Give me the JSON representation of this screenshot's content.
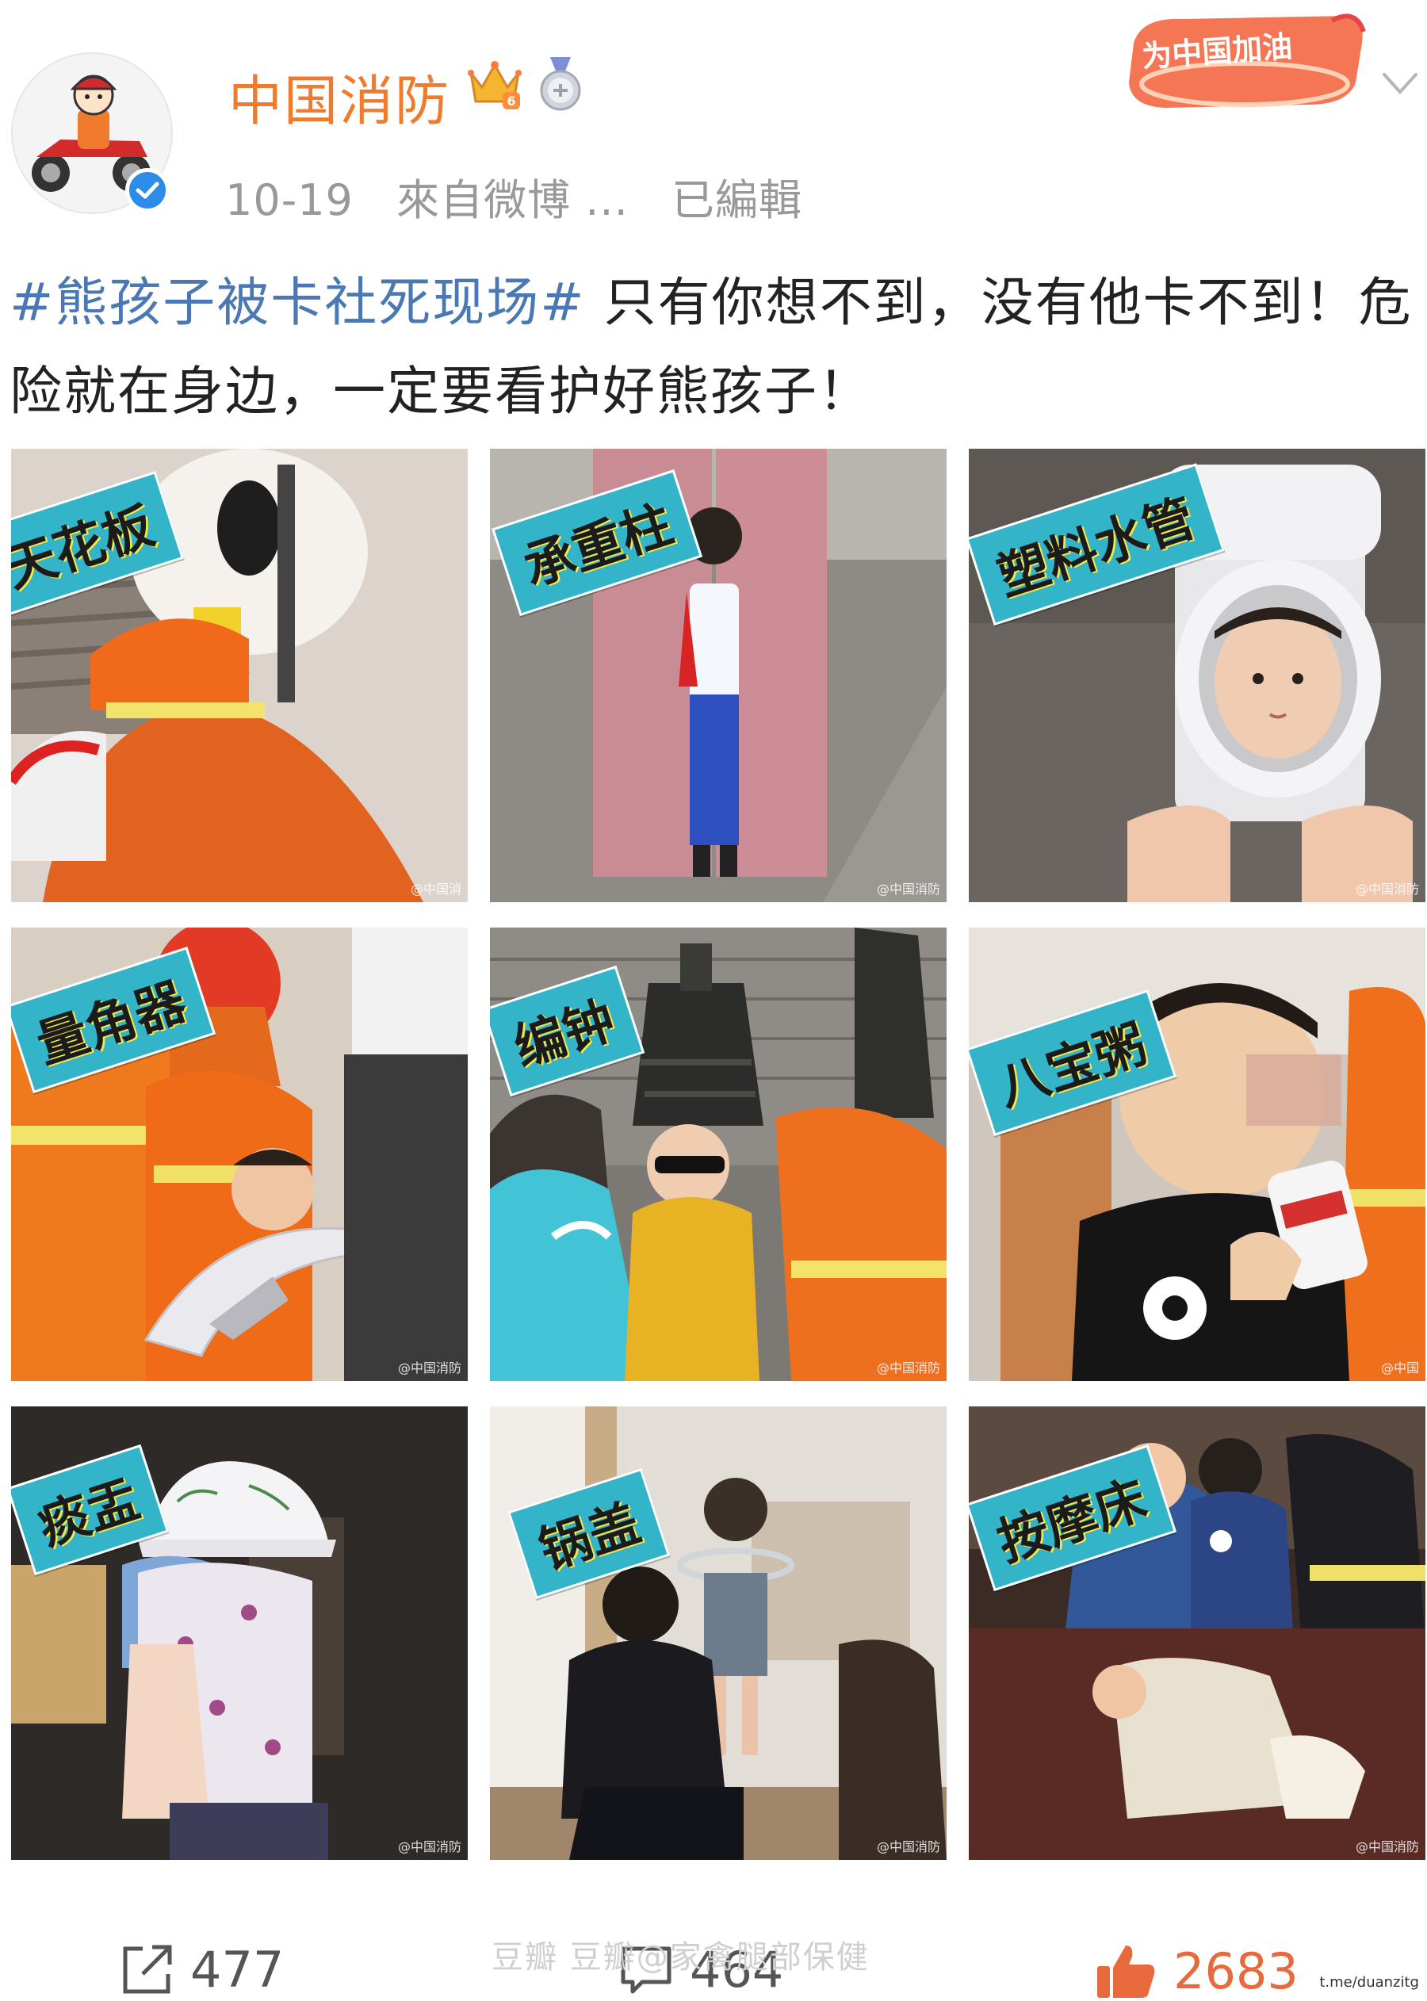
{
  "header": {
    "author": "中国消防",
    "date": "10-19",
    "source": "來自微博 ...",
    "edited": "已編輯",
    "badge_text": "为中国加油"
  },
  "post": {
    "hashtag": "#熊孩子被卡社死现场#",
    "text": " 只有你想不到，没有他卡不到！危险就在身边，一定要看护好熊孩子！"
  },
  "grid": {
    "items": [
      {
        "tag": "天花板",
        "watermark": "@中国消"
      },
      {
        "tag": "承重柱",
        "watermark": "@中国消防"
      },
      {
        "tag": "塑料水管",
        "watermark": "@中国消防"
      },
      {
        "tag": "量角器",
        "watermark": "@中国消防"
      },
      {
        "tag": "编钟",
        "watermark": "@中国消防"
      },
      {
        "tag": "八宝粥",
        "watermark": "@中国"
      },
      {
        "tag": "痰盂",
        "watermark": "@中国消防"
      },
      {
        "tag": "锅盖",
        "watermark": "@中国消防"
      },
      {
        "tag": "按摩床",
        "watermark": "@中国消防"
      }
    ]
  },
  "footer": {
    "share_count": "477",
    "comment_count": "464",
    "like_count": "2683",
    "douban_watermark": "豆瓣  豆瓣@家禽腿部保健",
    "site_watermark": "t.me/duanzitg"
  },
  "colors": {
    "author": "#f07b2d",
    "hashtag": "#4a78b3",
    "tag_bg": "#34b4c8",
    "like": "#e86a3c",
    "verified": "#2d8ce8"
  }
}
